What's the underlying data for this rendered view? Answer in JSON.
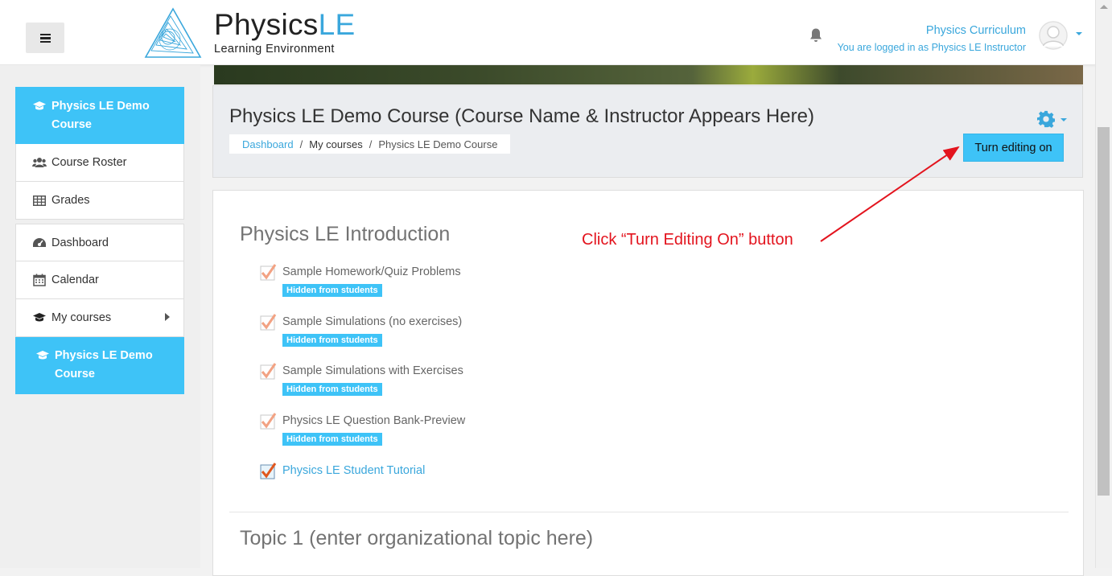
{
  "brand": {
    "title_main": "Physics",
    "title_accent": "LE",
    "subtitle": "Learning Environment"
  },
  "user": {
    "name": "Physics Curriculum",
    "login_text": "You are logged in as Physics LE Instructor"
  },
  "sidebar": {
    "groups": [
      {
        "items": [
          {
            "label": "Physics LE Demo Course",
            "icon": "graduation-cap-icon",
            "active": true
          },
          {
            "label": "Course Roster",
            "icon": "users-icon"
          },
          {
            "label": "Grades",
            "icon": "table-icon"
          }
        ]
      },
      {
        "items": [
          {
            "label": "Dashboard",
            "icon": "dashboard-icon"
          },
          {
            "label": "Calendar",
            "icon": "calendar-icon"
          },
          {
            "label": "My courses",
            "icon": "graduation-cap-icon",
            "has_submenu": true
          },
          {
            "label": "Physics LE Demo Course",
            "icon": "graduation-cap-icon",
            "active": true
          }
        ]
      }
    ]
  },
  "course": {
    "title": "Physics LE Demo Course (Course Name & Instructor Appears Here)",
    "breadcrumb": [
      "Dashboard",
      "My courses",
      "Physics LE Demo Course"
    ],
    "edit_button": "Turn editing on"
  },
  "section": {
    "title": "Physics LE Introduction",
    "activities": [
      {
        "name": "Sample Homework/Quiz Problems",
        "badge": "Hidden from students"
      },
      {
        "name": "Sample Simulations (no exercises)",
        "badge": "Hidden from students"
      },
      {
        "name": "Sample Simulations with Exercises",
        "badge": "Hidden from students"
      },
      {
        "name": "Physics LE Question Bank-Preview",
        "badge": "Hidden from students"
      },
      {
        "name": "Physics LE Student Tutorial",
        "badge": ""
      }
    ]
  },
  "topic": {
    "title": "Topic 1 (enter organizational topic here)"
  },
  "annotation": {
    "text": "Click “Turn Editing On” button"
  },
  "colors": {
    "accent": "#3ec3f7",
    "link": "#3aa7dc",
    "annotation": "#e3141e"
  }
}
